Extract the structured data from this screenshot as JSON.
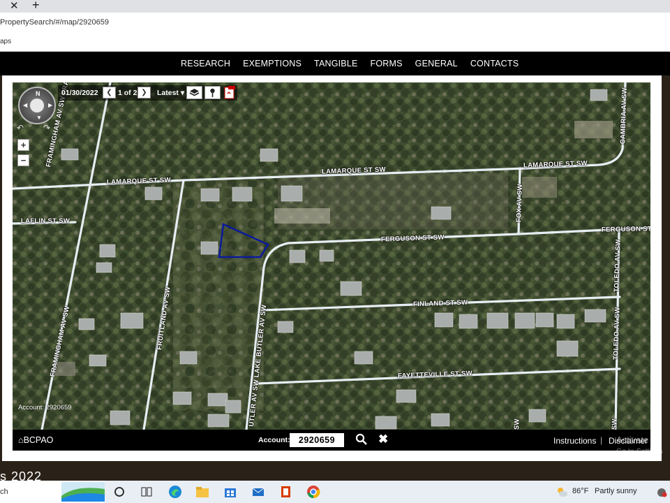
{
  "browser": {
    "url": "PropertySearch/#/map/2920659",
    "bookmarks_text": "aps"
  },
  "nav": {
    "items": [
      "RESEARCH",
      "EXEMPTIONS",
      "TANGIBLE",
      "FORMS",
      "GENERAL",
      "CONTACTS"
    ]
  },
  "map": {
    "date": "01/30/2022",
    "page": "1 of 2",
    "latest_label": "Latest",
    "compass_north": "N",
    "zoom_in": "+",
    "zoom_out": "−",
    "account_watermark": "Account: 2920659",
    "streets": {
      "lamarque_w": "LAMARQUE ST SW",
      "lamarque_c": "LAMARQUE ST SW",
      "lamarque_e": "LAMARQUE ST SW",
      "laflin": "LAFLIN ST SW",
      "framingham_top": "FRAMINGHAM AV SW FRAMINGHAM AV SW",
      "framingham_bottom": "FRAMINGHAM AV SW",
      "fruitland": "FRUITLAND AV SW",
      "butler": "UTLER AV SW LAKE BUTLER AV SW",
      "ferguson_c": "FERGUSON ST SW",
      "ferguson_e": "FERGUSON ST",
      "fox": "FOX AV SW",
      "finland": "FINLAND ST SW",
      "fayetteville": "FAYETTEVILLE ST SW",
      "cambria": "CAMBRIA AV SW",
      "toledo_top": "TOLEDO AV SW",
      "toledo_bottom": "TOLEDO AV SW",
      "toledo_frag": "SW",
      "bottom_frag": "SW"
    },
    "parcel_color": "#0a1a9c"
  },
  "bottom_bar": {
    "brand": "BCPAO",
    "account_label": "Account:",
    "account_value": "2920659",
    "instructions": "Instructions",
    "disclaimer": "Disclaimer"
  },
  "watermark": {
    "line1": "Activate W",
    "line2": "Go to Settings"
  },
  "desktop": {
    "year_text": "s 2022"
  },
  "taskbar": {
    "search_text": "ch",
    "weather_temp": "86°F",
    "weather_desc": "Partly sunny"
  }
}
